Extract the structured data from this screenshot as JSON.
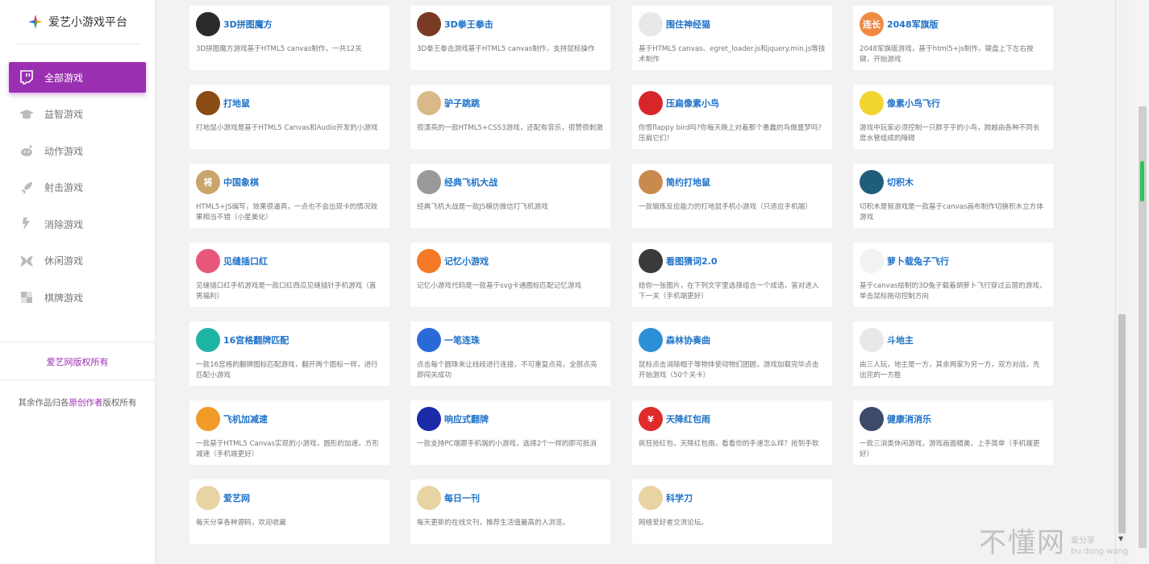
{
  "sidebar": {
    "brand": "爱艺小游戏平台",
    "nav": [
      {
        "label": "全部游戏",
        "icon": "twitch-icon",
        "active": true
      },
      {
        "label": "益智游戏",
        "icon": "graduation-cap-icon",
        "active": false
      },
      {
        "label": "动作游戏",
        "icon": "reddit-icon",
        "active": false
      },
      {
        "label": "射击游戏",
        "icon": "rocket-icon",
        "active": false
      },
      {
        "label": "消除游戏",
        "icon": "eliminate-icon",
        "active": false
      },
      {
        "label": "休闲游戏",
        "icon": "leisure-icon",
        "active": false
      },
      {
        "label": "棋牌游戏",
        "icon": "chessboard-icon",
        "active": false
      }
    ],
    "copyright_main": "爱艺网版权所有",
    "copyright_other_prefix": "其余作品归各",
    "copyright_other_link": "原创作者",
    "copyright_other_suffix": "版权所有"
  },
  "games": [
    {
      "title": "3D拼图魔方",
      "desc": "3D拼图魔方游戏基于HTML5 canvas制作，一共12关",
      "icon": "rubik-icon",
      "color": "#2b2b2b"
    },
    {
      "title": "3D拳王拳击",
      "desc": "3D拳王拳击游戏基于HTML5 canvas制作，支持鼠标操作",
      "icon": "boxer-icon",
      "color": "#7a3b24"
    },
    {
      "title": "围住神经猫",
      "desc": "基于HTML5 canvas、egret_loader.js和jquery.min.js等技术制作",
      "icon": "cat-icon",
      "color": "#e8e8e8"
    },
    {
      "title": "2048军旗版",
      "desc": "2048军旗版游戏，基于html5+js制作，键盘上下左右按键，开始游戏",
      "icon": "2048-icon",
      "color": "#f08a43",
      "badge": "连长"
    },
    {
      "title": "打地鼠",
      "desc": "打地鼠小游戏是基于HTML5 Canvas和Audio开发的小游戏",
      "icon": "hammer-icon",
      "color": "#8b4b14"
    },
    {
      "title": "驴子跳跳",
      "desc": "很漂亮的一款HTML5+CSS3游戏，还配有音乐，很赞很刺激",
      "icon": "donkey-icon",
      "color": "#d9b98a"
    },
    {
      "title": "压扁像素小鸟",
      "desc": "你恨flappy bird吗?你每天晚上对着那个愚蠢的鸟做噩梦吗？压扁它们！",
      "icon": "red-bird-icon",
      "color": "#d6262a"
    },
    {
      "title": "像素小鸟飞行",
      "desc": "游戏中玩家必须控制一只胖乎乎的小鸟，跨越由各种不同长度水管组成的障碍",
      "icon": "flappy-bird-icon",
      "color": "#f3d532"
    },
    {
      "title": "中国象棋",
      "desc": "HTML5+JS编写，效果很逼真，一点也不会出现卡的情况效果相当不错（小星美化）",
      "icon": "chinese-chess-icon",
      "color": "#c9a46b",
      "badge": "将"
    },
    {
      "title": "经典飞机大战",
      "desc": "经典飞机大战是一款JS模仿微信打飞机游戏",
      "icon": "plane-icon",
      "color": "#9a9a9a"
    },
    {
      "title": "简约打地鼠",
      "desc": "一款锻炼反应能力的打地鼠手机小游戏（只适应手机端）",
      "icon": "mole-icon",
      "color": "#c98b4d"
    },
    {
      "title": "切积木",
      "desc": "切积木是智游戏是一款基于canvas画布制作切换积木立方体游戏",
      "icon": "blocks-icon",
      "color": "#1f5d7a"
    },
    {
      "title": "见缝插口红",
      "desc": "见缝插口红手机游戏是一款口红西瓜见缝插针手机游戏（直男福利）",
      "icon": "lipstick-icon",
      "color": "#e8577a"
    },
    {
      "title": "记忆小游戏",
      "desc": "记忆小游戏代码是一款基于svg卡通图标匹配记忆游戏",
      "icon": "panda-icon",
      "color": "#f47a27"
    },
    {
      "title": "看图猜词2.0",
      "desc": "给你一张图片，在下列文字里选择组合一个成语，答对进入下一关（手机端更好）",
      "icon": "eye-icon",
      "color": "#3a3a3a"
    },
    {
      "title": "萝卜载兔子飞行",
      "desc": "基于canvas绘制的3D兔子载着胡萝卜飞行穿过云层的游戏，单击鼠标拖动控制方向",
      "icon": "rabbit-icon",
      "color": "#f2f2f2"
    },
    {
      "title": "16宫格翻牌匹配",
      "desc": "一款16宫格的翻牌图标匹配游戏，翻开两个图标一样，进行匹配小游戏",
      "icon": "anchor-icon",
      "color": "#1fb5a5"
    },
    {
      "title": "一笔连珠",
      "desc": "点击每个圆珠来让线段进行连接，不可重复点亮，全部点亮即闯关成功",
      "icon": "ball-icon",
      "color": "#2a6ad8"
    },
    {
      "title": "森林协奏曲",
      "desc": "鼠标点击消除帽子等物体使动物们团圆，游戏加载完毕点击开始游戏（50个关卡）",
      "icon": "forest-icon",
      "color": "#2d8fd6"
    },
    {
      "title": "斗地主",
      "desc": "由三人玩，地主是一方，其余两家为另一方，双方对战，先出完的一方胜",
      "icon": "landlord-icon",
      "color": "#e8e8e8"
    },
    {
      "title": "飞机加减速",
      "desc": "一款基于HTML5 Canvas实现的小游戏，圆形的加速，方形减速（手机端更好）",
      "icon": "spaceship-icon",
      "color": "#f19b28"
    },
    {
      "title": "响应式翻牌",
      "desc": "一款支持PC端跟手机端的小游戏，选择2个一样的即可抵消",
      "icon": "eye-circle-icon",
      "color": "#1a2aa8"
    },
    {
      "title": "天降红包雨",
      "desc": "疯狂抢红包，天降红包雨，看看你的手速怎么样？抢到手软",
      "icon": "red-envelope-icon",
      "color": "#e02b2b",
      "badge": "¥"
    },
    {
      "title": "健康消消乐",
      "desc": "一款三消类休闲游戏，游戏画面精美，上手简单（手机端更好）",
      "icon": "ninja-icon",
      "color": "#3c4a6b"
    },
    {
      "title": "爱艺网",
      "desc": "每天分享各种源码，欢迎收藏",
      "icon": "aiyi-mascot-icon",
      "color": "#e8d3a3"
    },
    {
      "title": "每日一刊",
      "desc": "每天更新的在线文刊，推荐生活值最高的人浏览。",
      "icon": "aiyi-mascot-icon",
      "color": "#e8d3a3"
    },
    {
      "title": "科学刀",
      "desc": "网络爱好者交流论坛。",
      "icon": "aiyi-mascot-icon",
      "color": "#e8d3a3"
    }
  ],
  "watermark": {
    "big": "不懂网",
    "small1": "爱分享",
    "small2": "bu dong wang"
  }
}
